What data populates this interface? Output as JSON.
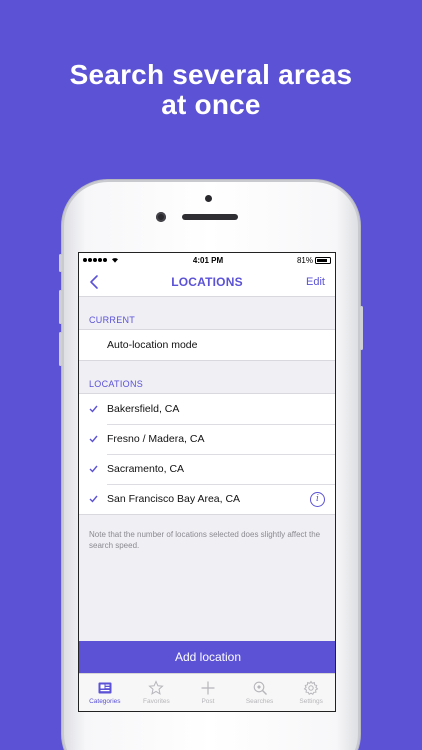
{
  "headline": {
    "line1": "Search several areas",
    "line2": "at once"
  },
  "status": {
    "time": "4:01 PM",
    "battery": "81%",
    "battery_level": 0.81
  },
  "nav": {
    "title": "LOCATIONS",
    "edit": "Edit",
    "back_icon": "chevron-left-icon"
  },
  "current": {
    "header": "CURRENT",
    "items": [
      {
        "label": "Auto-location mode"
      }
    ]
  },
  "locations": {
    "header": "LOCATIONS",
    "items": [
      {
        "label": "Bakersfield, CA",
        "checked": true
      },
      {
        "label": "Fresno / Madera, CA",
        "checked": true
      },
      {
        "label": "Sacramento, CA",
        "checked": true
      },
      {
        "label": "San Francisco Bay Area, CA",
        "checked": true,
        "info": true
      }
    ]
  },
  "note": "Note that the number of locations selected does slightly affect the search speed.",
  "add_button": "Add location",
  "tabs": [
    {
      "label": "Categories",
      "icon": "categories-icon",
      "active": true
    },
    {
      "label": "Favorites",
      "icon": "star-icon",
      "active": false
    },
    {
      "label": "Post",
      "icon": "plus-icon",
      "active": false
    },
    {
      "label": "Searches",
      "icon": "search-icon",
      "active": false
    },
    {
      "label": "Settings",
      "icon": "gear-icon",
      "active": false
    }
  ],
  "colors": {
    "accent": "#5b52d6",
    "background": "#5b52d6"
  }
}
